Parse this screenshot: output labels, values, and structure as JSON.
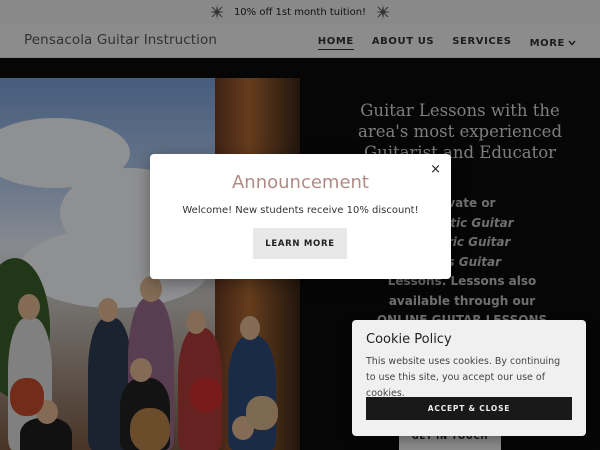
{
  "promo": {
    "text": "10% off 1st month tuition!",
    "icon": "sparkle-icon"
  },
  "header": {
    "brand": "Pensacola Guitar Instruction",
    "nav": [
      {
        "label": "HOME",
        "active": true
      },
      {
        "label": "ABOUT US",
        "active": false
      },
      {
        "label": "SERVICES",
        "active": false
      },
      {
        "label": "MORE",
        "active": false
      }
    ]
  },
  "hero": {
    "headline": "Guitar Lessons with the area's most experienced Guitarist and Educator",
    "body_lines": [
      "Private or",
      "Acoustic Guitar",
      "Electric Guitar",
      "Bass Guitar",
      "Lessons. Lessons also",
      "available through our",
      "ONLINE GUITAR LESSONS"
    ],
    "cta": "GET IN TOUCH"
  },
  "modal": {
    "title": "Announcement",
    "message": "Welcome! New students receive 10% discount!",
    "button": "LEARN MORE",
    "close": "×"
  },
  "cookie": {
    "title": "Cookie Policy",
    "text": "This website uses cookies. By continuing to use this site, you accept our use of cookies.",
    "button": "ACCEPT & CLOSE"
  },
  "colors": {
    "modal_title": "#b08b86",
    "hero_bg": "#0c0c0c",
    "header_bg": "#f2f2f2"
  }
}
